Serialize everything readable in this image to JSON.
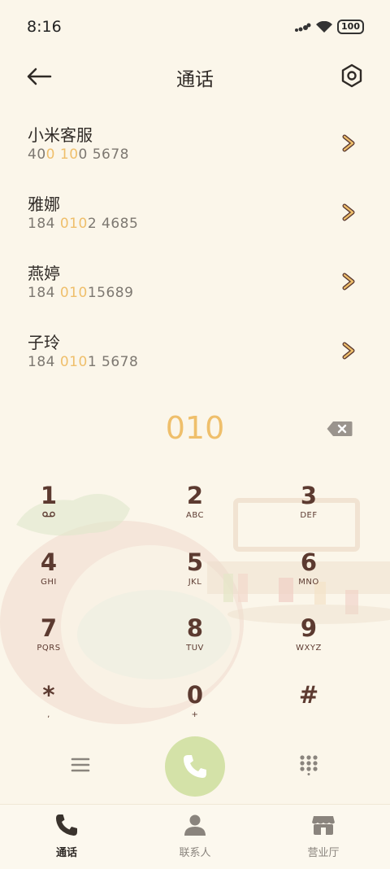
{
  "status_bar": {
    "time": "8:16",
    "battery": "100"
  },
  "header": {
    "title": "通话"
  },
  "contacts": [
    {
      "name": "小米客服",
      "number_parts": [
        [
          "40",
          0
        ],
        [
          "0",
          1
        ],
        [
          " ",
          0
        ],
        [
          "10",
          1
        ],
        [
          "0 5678",
          0
        ]
      ]
    },
    {
      "name": "雅娜",
      "number_parts": [
        [
          "184 ",
          0
        ],
        [
          "010",
          1
        ],
        [
          "2 4685",
          0
        ]
      ]
    },
    {
      "name": "燕婷",
      "number_parts": [
        [
          "184 ",
          0
        ],
        [
          "010",
          1
        ],
        [
          "15689",
          0
        ]
      ]
    },
    {
      "name": "子玲",
      "number_parts": [
        [
          "184 ",
          0
        ],
        [
          "010",
          1
        ],
        [
          "1 5678",
          0
        ]
      ]
    }
  ],
  "dial_display": "010",
  "keypad": [
    {
      "digit": "1",
      "letters": "voicemail-icon"
    },
    {
      "digit": "2",
      "letters": "ABC"
    },
    {
      "digit": "3",
      "letters": "DEF"
    },
    {
      "digit": "4",
      "letters": "GHI"
    },
    {
      "digit": "5",
      "letters": "JKL"
    },
    {
      "digit": "6",
      "letters": "MNO"
    },
    {
      "digit": "7",
      "letters": "PQRS"
    },
    {
      "digit": "8",
      "letters": "TUV"
    },
    {
      "digit": "9",
      "letters": "WXYZ"
    },
    {
      "digit": "*",
      "letters": ","
    },
    {
      "digit": "0",
      "letters": "+"
    },
    {
      "digit": "#",
      "letters": ""
    }
  ],
  "tabs": [
    {
      "label": "通话",
      "icon": "phone-icon",
      "active": true
    },
    {
      "label": "联系人",
      "icon": "person-icon",
      "active": false
    },
    {
      "label": "营业厅",
      "icon": "store-icon",
      "active": false
    }
  ],
  "colors": {
    "accent": "#efbf6b",
    "call_button": "#d4e2a8",
    "key_text": "#5c3a30",
    "background": "#fbf6ea"
  }
}
